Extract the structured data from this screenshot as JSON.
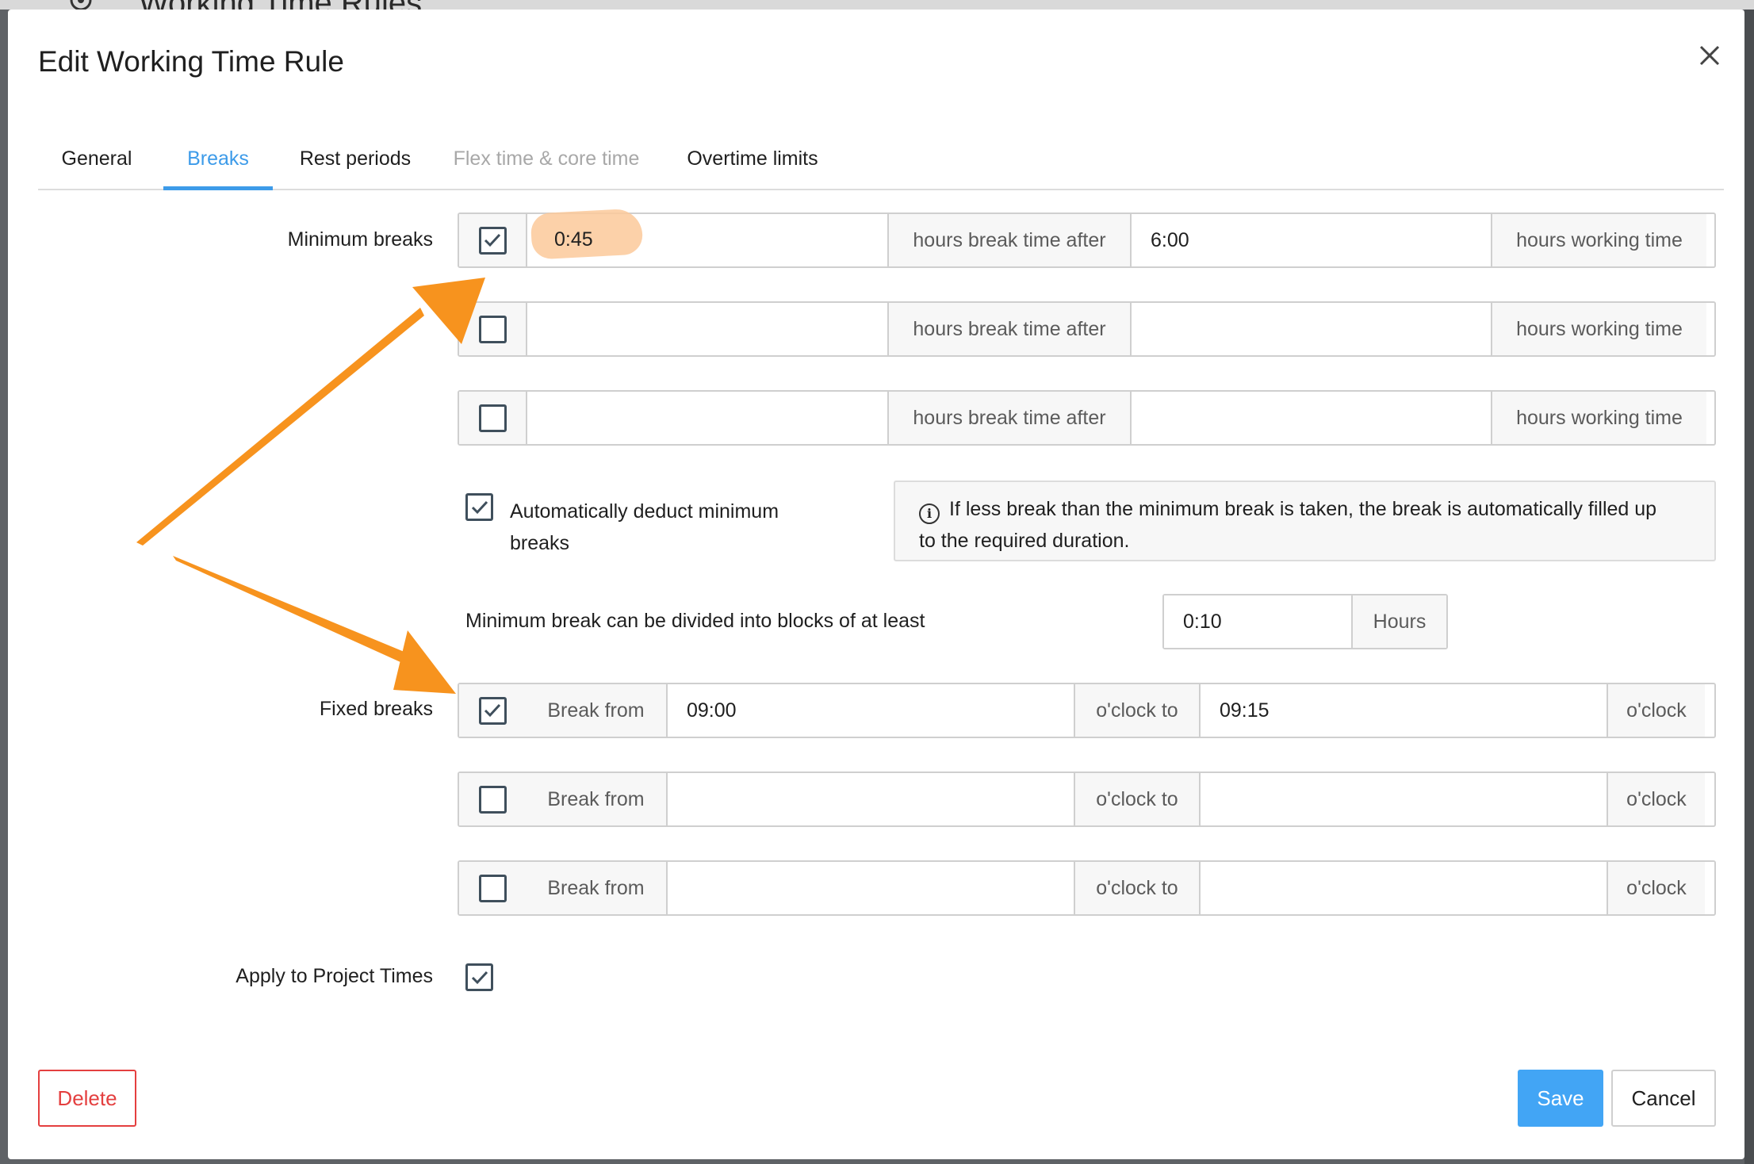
{
  "background": {
    "page_title": "Working Time Rules",
    "gear_icon": "gear-icon"
  },
  "dialog": {
    "title": "Edit Working Time Rule",
    "close_icon": "close-icon"
  },
  "tabs": [
    {
      "label": "General",
      "state": "normal"
    },
    {
      "label": "Breaks",
      "state": "active"
    },
    {
      "label": "Rest periods",
      "state": "normal"
    },
    {
      "label": "Flex time & core time",
      "state": "disabled"
    },
    {
      "label": "Overtime limits",
      "state": "normal"
    }
  ],
  "minimum_breaks": {
    "label": "Minimum breaks",
    "rows": [
      {
        "checked": true,
        "break_value": "0:45",
        "after_text": "hours break time after",
        "working_value": "6:00",
        "working_text": "hours working time"
      },
      {
        "checked": false,
        "break_value": "",
        "after_text": "hours break time after",
        "working_value": "",
        "working_text": "hours working time"
      },
      {
        "checked": false,
        "break_value": "",
        "after_text": "hours break time after",
        "working_value": "",
        "working_text": "hours working time"
      }
    ]
  },
  "auto_deduct": {
    "checked": true,
    "label_line1": "Automatically deduct minimum",
    "label_line2": "breaks",
    "info_icon": "info-icon",
    "info_line1": "If less break than the minimum break is taken, the break is automatically filled up",
    "info_line2": "to the required duration."
  },
  "divide_blocks": {
    "label": "Minimum break can be divided into blocks of at least",
    "value": "0:10",
    "unit": "Hours"
  },
  "fixed_breaks": {
    "label": "Fixed breaks",
    "rows": [
      {
        "checked": true,
        "from_text": "Break from",
        "from_value": "09:00",
        "to_text": "o'clock to",
        "to_value": "09:15",
        "end_text": "o'clock"
      },
      {
        "checked": false,
        "from_text": "Break from",
        "from_value": "",
        "to_text": "o'clock to",
        "to_value": "",
        "end_text": "o'clock"
      },
      {
        "checked": false,
        "from_text": "Break from",
        "from_value": "",
        "to_text": "o'clock to",
        "to_value": "",
        "end_text": "o'clock"
      }
    ]
  },
  "apply_project": {
    "label": "Apply to Project Times",
    "checked": true
  },
  "footer": {
    "delete_label": "Delete",
    "save_label": "Save",
    "cancel_label": "Cancel"
  },
  "colors": {
    "accent": "#42a5f5",
    "tab_active": "#3d9be9",
    "danger": "#e43f3f",
    "annotation_arrow": "#f7931e",
    "highlight": "#fcc99a"
  }
}
